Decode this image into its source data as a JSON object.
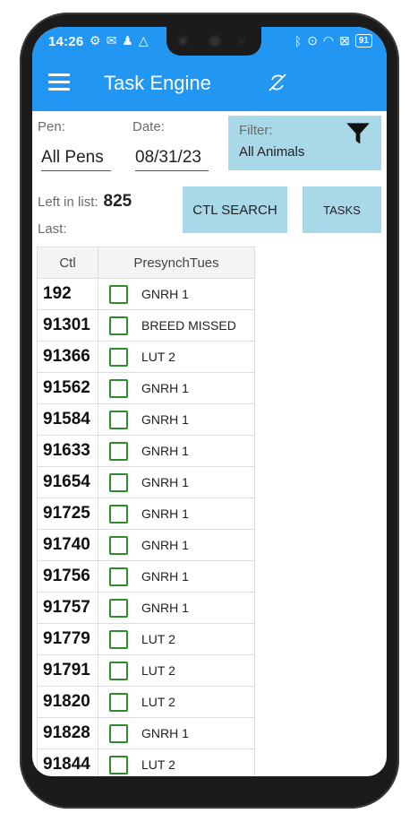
{
  "status": {
    "time": "14:26",
    "battery": "91"
  },
  "app": {
    "title": "Task Engine"
  },
  "filters": {
    "pen_label": "Pen:",
    "pen_value": "All Pens",
    "date_label": "Date:",
    "date_value": "08/31/23",
    "filter_label": "Filter:",
    "filter_value": "All Animals"
  },
  "summary": {
    "left_label": "Left in list:",
    "left_count": "825",
    "last_label": "Last:"
  },
  "buttons": {
    "ctl_search": "CTL SEARCH",
    "tasks": "TASKS"
  },
  "table": {
    "columns": [
      "Ctl",
      "PresynchTues"
    ],
    "rows": [
      {
        "ctl": "192",
        "task": "GNRH 1"
      },
      {
        "ctl": "91301",
        "task": "BREED MISSED"
      },
      {
        "ctl": "91366",
        "task": "LUT 2"
      },
      {
        "ctl": "91562",
        "task": "GNRH 1"
      },
      {
        "ctl": "91584",
        "task": "GNRH 1"
      },
      {
        "ctl": "91633",
        "task": "GNRH 1"
      },
      {
        "ctl": "91654",
        "task": "GNRH 1"
      },
      {
        "ctl": "91725",
        "task": "GNRH 1"
      },
      {
        "ctl": "91740",
        "task": "GNRH 1"
      },
      {
        "ctl": "91756",
        "task": "GNRH 1"
      },
      {
        "ctl": "91757",
        "task": "GNRH 1"
      },
      {
        "ctl": "91779",
        "task": "LUT 2"
      },
      {
        "ctl": "91791",
        "task": "LUT 2"
      },
      {
        "ctl": "91820",
        "task": "LUT 2"
      },
      {
        "ctl": "91828",
        "task": "GNRH 1"
      },
      {
        "ctl": "91844",
        "task": "LUT 2"
      }
    ]
  },
  "colors": {
    "app_bar": "#2196f3",
    "button_bg": "#a9d8e9",
    "checkbox": "#2e8b2e"
  },
  "icons": {
    "menu": "hamburger-menu-icon",
    "sync": "sync-disabled-icon",
    "filter": "funnel-icon",
    "checkbox": "checkbox-unchecked-icon"
  }
}
